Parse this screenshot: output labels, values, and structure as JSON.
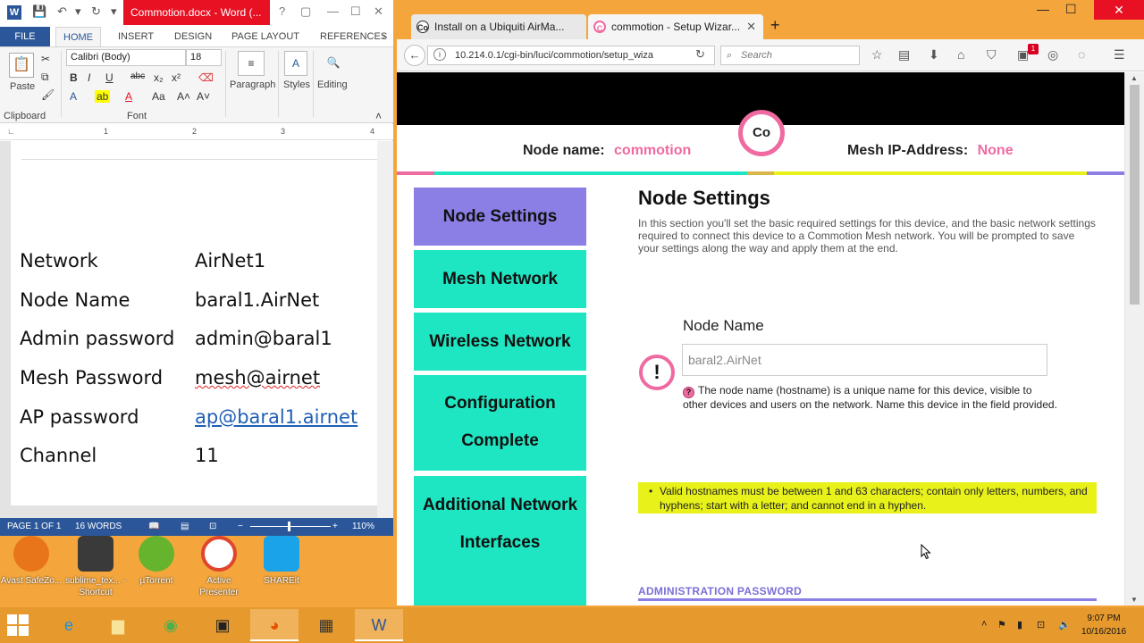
{
  "word": {
    "title": "Commotion.docx - Word (...",
    "ctl_help": "?",
    "file_tab": "FILE",
    "tabs": [
      "HOME",
      "INSERT",
      "DESIGN",
      "PAGE LAYOUT",
      "REFERENCES"
    ],
    "ribbon": {
      "paste": "Paste",
      "clipboard": "Clipboard",
      "font_name": "Calibri (Body)",
      "font_size": "18",
      "font_group": "Font",
      "paragraph": "Paragraph",
      "styles": "Styles",
      "editing": "Editing"
    },
    "ruler": [
      "1",
      "2",
      "3",
      "4"
    ],
    "doc_rows": [
      {
        "label": "Network",
        "value": "AirNet1"
      },
      {
        "label": "Node Name",
        "value": "baral1.AirNet"
      },
      {
        "label": "Admin password",
        "value": "admin@baral1"
      },
      {
        "label": "Mesh Password",
        "value": "mesh@airnet"
      },
      {
        "label": "AP password",
        "value": "ap@baral1.airnet"
      },
      {
        "label": "Channel",
        "value": "11"
      }
    ],
    "status": {
      "page": "PAGE 1 OF 1",
      "words": "16 WORDS",
      "zoom": "110%"
    }
  },
  "desktop_icons": [
    {
      "label": "Avast SafeZo..."
    },
    {
      "label": "sublime_tex... - Shortcut"
    },
    {
      "label": "µTorrent"
    },
    {
      "label": "Active Presenter"
    },
    {
      "label": "SHAREit"
    }
  ],
  "firefox": {
    "tabs": [
      {
        "title": "Install on a Ubiquiti AirMa..."
      },
      {
        "title": "commotion - Setup Wizar..."
      }
    ],
    "url": "10.214.0.1/cgi-bin/luci/commotion/setup_wiza",
    "search_placeholder": "Search",
    "badge_count": "1"
  },
  "commotion": {
    "logo": "Co",
    "node_name_label": "Node name:",
    "node_name_value": "commotion",
    "mesh_ip_label": "Mesh IP-Address:",
    "mesh_ip_value": "None",
    "menu": [
      {
        "label": "Node Settings"
      },
      {
        "label": "Mesh Network"
      },
      {
        "label": "Wireless Network"
      },
      {
        "label": "Configuration Complete"
      },
      {
        "label": "Additional Network Interfaces"
      }
    ],
    "heading": "Node Settings",
    "intro": "In this section you'll set the basic required settings for this device, and the basic network settings required to connect this device to a Commotion Mesh network. You will be prompted to save your settings along the way and apply them at the end.",
    "field_label": "Node Name",
    "field_value": "baral2.AirNet",
    "help_text": "The node name (hostname) is a unique name for this device, visible to other devices and users on the network. Name this device in the field provided.",
    "note": "Valid hostnames must be between 1 and 63 characters; contain only letters, numbers, and hyphens; start with a letter; and cannot end in a hyphen.",
    "section_title": "ADMINISTRATION PASSWORD"
  },
  "taskbar": {
    "time": "9:07 PM",
    "date": "10/16/2016"
  },
  "colors": {
    "pink": "#ef6aa0",
    "teal": "#1fe6c2",
    "purple": "#8b7fe6",
    "note_yellow": "#e8f21a",
    "desktop": "#f4a63c",
    "word_blue": "#2b579a"
  }
}
